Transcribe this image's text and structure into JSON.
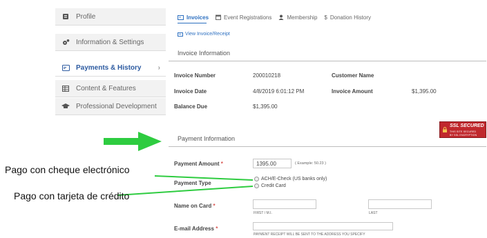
{
  "sidebar": {
    "items": [
      {
        "label": "Profile",
        "icon": "id-card-icon"
      },
      {
        "label": "Information & Settings",
        "icon": "gears-icon"
      },
      {
        "label": "Payments & History",
        "icon": "credit-card-icon",
        "active": true
      },
      {
        "label": "Content & Features",
        "icon": "grid-icon"
      },
      {
        "label": "Professional Development",
        "icon": "graduation-cap-icon"
      }
    ]
  },
  "tabs": [
    {
      "label": "Invoices",
      "active": true
    },
    {
      "label": "Event Registrations"
    },
    {
      "label": "Membership"
    },
    {
      "label": "Donation History"
    }
  ],
  "view_link": "View Invoice/Receipt",
  "invoice_info": {
    "title": "Invoice Information",
    "number_label": "Invoice Number",
    "number_value": "200010218",
    "customer_label": "Customer Name",
    "date_label": "Invoice Date",
    "date_value": "4/8/2019 6:01:12 PM",
    "amount_label": "Invoice Amount",
    "amount_value": "$1,395.00",
    "balance_label": "Balance Due",
    "balance_value": "$1,395.00"
  },
  "payment_info": {
    "title": "Payment Information",
    "amount_label": "Payment Amount",
    "amount_value": "1395.00",
    "amount_example": "( Example: 50.23 )",
    "type_label": "Payment Type",
    "type_options": [
      "ACH/E-Check (US banks only)",
      "Credit Card"
    ],
    "name_label": "Name on Card",
    "first_hint": "FIRST / M.I.",
    "last_hint": "LAST",
    "email_label": "E-mail Address",
    "email_hint": "PAYMENT RECEIPT WILL BE SENT TO THE ADDRESS YOU SPECIFY"
  },
  "ssl_badge": {
    "title": "SSL SECURED",
    "line1": "THIS SITE SECURED",
    "line2": "BY SSL ENCRYPTION"
  },
  "annotations": {
    "echeck": "Pago con cheque electrónico",
    "card": "Pago con tarjeta de crédito"
  },
  "colors": {
    "accent": "#2c6fc0",
    "arrow": "#2ecc40",
    "ssl": "#c0282d"
  }
}
